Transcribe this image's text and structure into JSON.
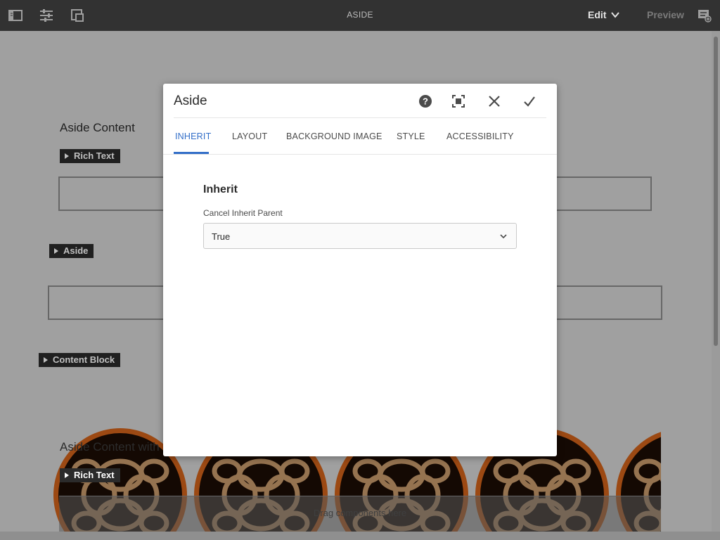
{
  "topbar": {
    "title": "ASIDE",
    "edit_label": "Edit",
    "preview_label": "Preview",
    "icons": [
      "sidebar-toggle-icon",
      "properties-sliders-icon",
      "emulator-icon",
      "annotations-icon",
      "chevron-down-icon"
    ]
  },
  "page": {
    "heading1": "Aside Content",
    "heading2": "Aside Content with",
    "tags": {
      "rich_text_1": "Rich Text",
      "aside": "Aside",
      "content_block": "Content Block",
      "rich_text_2": "Rich Text"
    },
    "dropzone_text": "Drag components here"
  },
  "dialog": {
    "title": "Aside",
    "tabs": [
      {
        "label": "INHERIT",
        "active": true
      },
      {
        "label": "LAYOUT",
        "active": false
      },
      {
        "label": "BACKGROUND IMAGE",
        "active": false
      },
      {
        "label": "STYLE",
        "active": false
      },
      {
        "label": "ACCESSIBILITY",
        "active": false
      }
    ],
    "section_title": "Inherit",
    "field_label": "Cancel Inherit Parent",
    "select_value": "True",
    "icons": [
      "help-icon",
      "fullscreen-icon",
      "close-icon",
      "checkmark-icon"
    ]
  },
  "colors": {
    "toolbar_bg": "#323232",
    "accent": "#326ec8",
    "tag_bg": "#2b2b2b",
    "circle_ring": "#d0621a",
    "circle_fill": "#1b0c04",
    "circle_pattern": "#c79a6b"
  }
}
